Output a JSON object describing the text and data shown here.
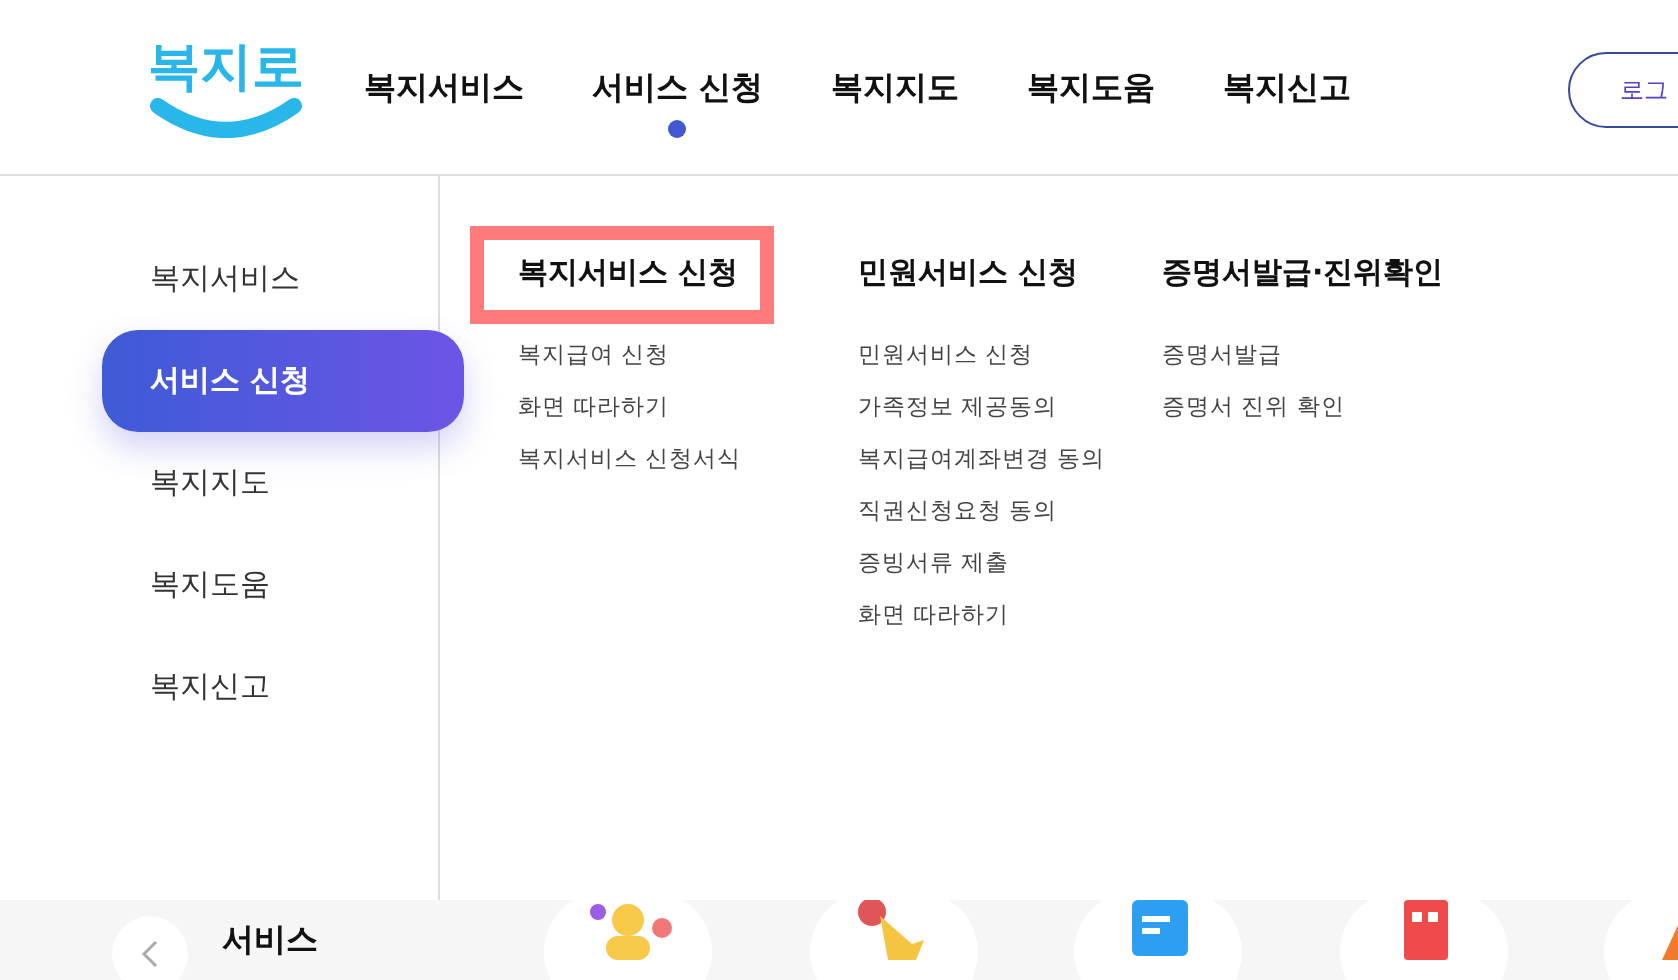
{
  "logo": {
    "text": "복지로"
  },
  "nav": [
    {
      "label": "복지서비스",
      "selected": false
    },
    {
      "label": "서비스 신청",
      "selected": true
    },
    {
      "label": "복지지도",
      "selected": false
    },
    {
      "label": "복지도움",
      "selected": false
    },
    {
      "label": "복지신고",
      "selected": false
    }
  ],
  "login_button": "로그",
  "side_menu": [
    {
      "label": "복지서비스",
      "selected": false
    },
    {
      "label": "서비스 신청",
      "selected": true
    },
    {
      "label": "복지지도",
      "selected": false
    },
    {
      "label": "복지도움",
      "selected": false
    },
    {
      "label": "복지신고",
      "selected": false
    }
  ],
  "submenu_columns": [
    {
      "heading": "복지서비스 신청",
      "highlighted": true,
      "items": [
        "복지급여 신청",
        "화면 따라하기",
        "복지서비스 신청서식"
      ]
    },
    {
      "heading": "민원서비스 신청",
      "highlighted": false,
      "items": [
        "민원서비스 신청",
        "가족정보 제공동의",
        "복지급여계좌변경 동의",
        "직권신청요청 동의",
        "증빙서류 제출",
        "화면 따라하기"
      ]
    },
    {
      "heading": "증명서발급·진위확인",
      "highlighted": false,
      "items": [
        "증명서발급",
        "증명서 진위 확인"
      ]
    }
  ],
  "bottom_strip": {
    "title": "서비스"
  }
}
